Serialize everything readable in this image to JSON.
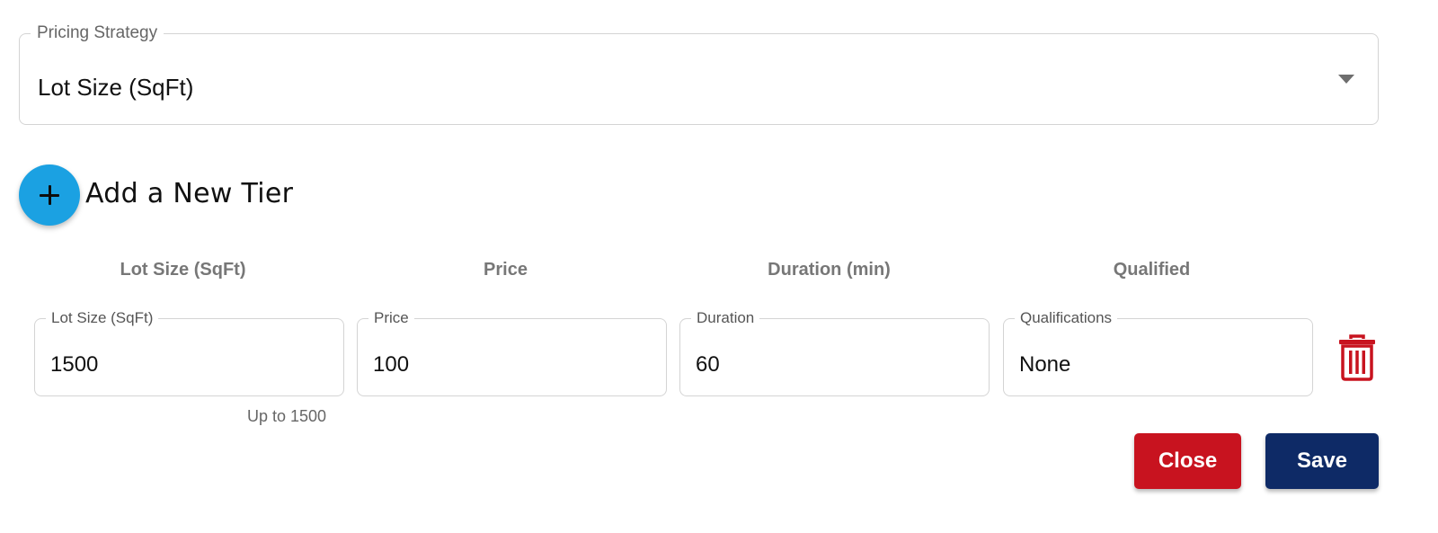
{
  "pricing_strategy": {
    "label": "Pricing Strategy",
    "selected": "Lot Size (SqFt)"
  },
  "add_tier": {
    "label": "Add a New Tier",
    "icon": "plus-icon",
    "color": "#1ba1e2"
  },
  "columns": [
    "Lot Size (SqFt)",
    "Price",
    "Duration (min)",
    "Qualified"
  ],
  "tier": {
    "lot_size": {
      "label": "Lot Size (SqFt)",
      "value": "1500",
      "helper": "Up to 1500"
    },
    "price": {
      "label": "Price",
      "value": "100"
    },
    "duration": {
      "label": "Duration",
      "value": "60"
    },
    "qualifications": {
      "label": "Qualifications",
      "value": "None"
    },
    "delete_icon": "trash-icon"
  },
  "actions": {
    "close_label": "Close",
    "save_label": "Save",
    "close_color": "#c8131f",
    "save_color": "#0e2a66"
  }
}
